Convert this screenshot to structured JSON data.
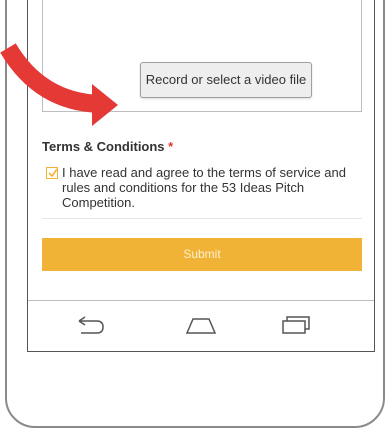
{
  "upload": {
    "button_label": "Record or select a video file"
  },
  "terms": {
    "title": "Terms & Conditions",
    "required_mark": "*",
    "checked": true,
    "text": "I have read and agree to the terms of service and rules and conditions for the 53 Ideas Pitch Competition."
  },
  "form": {
    "submit_label": "Submit"
  },
  "navbar": {
    "back_icon": "back-icon",
    "home_icon": "home-icon",
    "recents_icon": "recents-icon"
  },
  "colors": {
    "accent": "#f0b335",
    "required": "#e53935",
    "arrow": "#e53935"
  }
}
